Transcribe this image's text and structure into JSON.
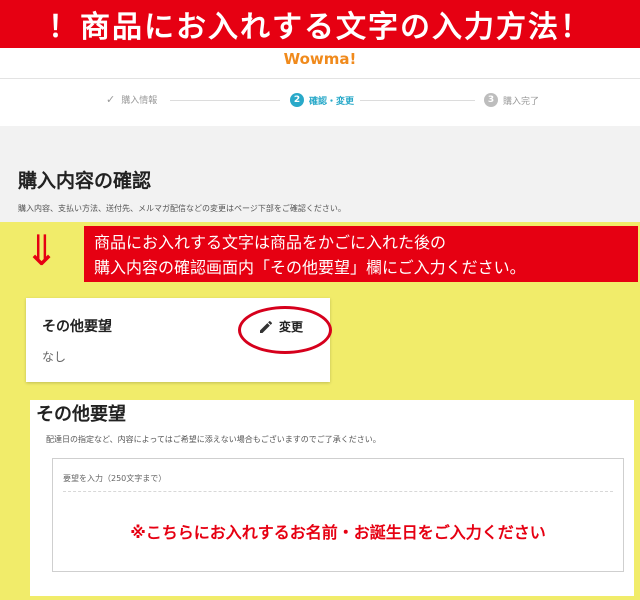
{
  "banner": {
    "title": "！商品にお入れする文字の入力方法！"
  },
  "logo": {
    "text": "Wowma!"
  },
  "colors": {
    "accent_red": "#e60012",
    "brand_orange": "#f08a1c",
    "step_active": "#29a9c9",
    "highlight_yellow": "#f1ec6a"
  },
  "steps": [
    {
      "num": "✓",
      "label": "購入情報",
      "state": "done"
    },
    {
      "num": "2",
      "label": "確認・変更",
      "state": "active"
    },
    {
      "num": "3",
      "label": "購入完了",
      "state": "pending"
    }
  ],
  "page": {
    "title": "購入内容の確認",
    "description": "購入内容、支払い方法、送付先、メルマガ配信などの変更はページ下部をご確認ください。"
  },
  "instruction": {
    "line1": "商品にお入れする文字は商品をかごに入れた後の",
    "line2": "購入内容の確認画面内「その他要望」欄にご入力ください。"
  },
  "arrows": {
    "glyph": "⇓"
  },
  "other_requests_card": {
    "title": "その他要望",
    "value": "なし",
    "edit_label": "変更",
    "edit_icon": "pencil-icon"
  },
  "other_requests_form": {
    "title": "その他要望",
    "description": "配達日の指定など、内容によってはご希望に添えない場合もございますのでご了承ください。",
    "textarea_placeholder": "要望を入力（250文字まで）",
    "note": "※こちらにお入れするお名前・お誕生日をご入力ください"
  }
}
